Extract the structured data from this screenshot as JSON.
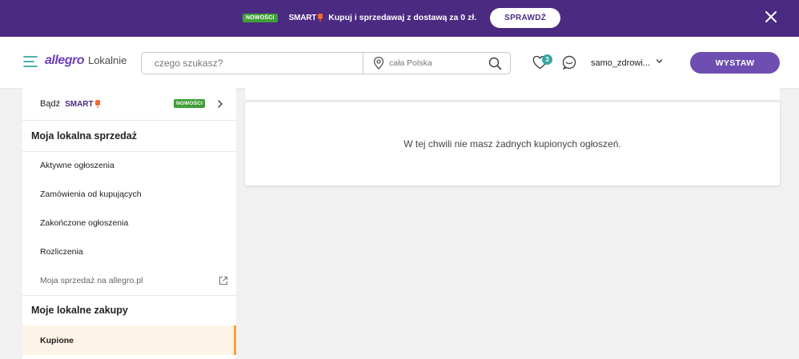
{
  "promo": {
    "badge": "NOWOŚCI",
    "smart_label": "SMART",
    "text": "Kupuj i sprzedawaj z dostawą za 0 zł.",
    "button": "SPRAWDŹ",
    "close_icon": "close-icon"
  },
  "header": {
    "menu_icon": "hamburger-icon",
    "brand_primary": "allegro",
    "brand_secondary": "Lokalnie",
    "search_placeholder": "czego szukasz?",
    "location_placeholder": "cała Polska",
    "favorites_count": "3",
    "user_name": "samo_zdrowi...",
    "cta_button": "WYSTAW"
  },
  "sidebar": {
    "smart_prefix": "Bądź",
    "smart_label": "SMART",
    "smart_badge": "NOWOŚCI",
    "sections": [
      {
        "title": "Moja lokalna sprzedaż",
        "items": [
          {
            "label": "Aktywne ogłoszenia"
          },
          {
            "label": "Zamówienia od kupujących"
          },
          {
            "label": "Zakończone ogłoszenia"
          },
          {
            "label": "Rozliczenia"
          },
          {
            "label": "Moja sprzedaż na allegro.pl",
            "external": true
          }
        ]
      },
      {
        "title": "Moje lokalne zakupy",
        "items": [
          {
            "label": "Kupione",
            "active": true
          }
        ]
      }
    ]
  },
  "main": {
    "empty_message": "W tej chwili nie masz żadnych kupionych ogłoszeń."
  },
  "colors": {
    "promo_bg": "#4b2a81",
    "brand": "#6e3fbc",
    "cta": "#6e4fb1",
    "badge_new": "#3f9f38",
    "active_accent": "#f0a43d",
    "favorites_badge": "#3aa5a0"
  }
}
